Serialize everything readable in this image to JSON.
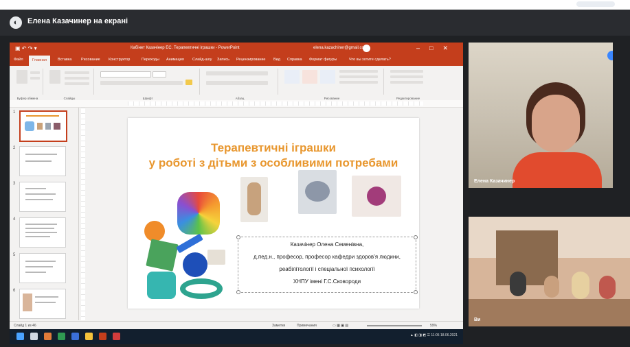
{
  "meet": {
    "presenter_banner": "Елена Казачинер на екрані",
    "presenter_tile_name": "Елена Казачинер",
    "group_tile_name": "Ви"
  },
  "ppt": {
    "window_title": "Кабінет Казачінер ЕС. Терапевтичні іграшки - PowerPoint",
    "account": "elena.kazachiner@gmail.com",
    "tabs": [
      "Файл",
      "Главная",
      "Вставка",
      "Рисование",
      "Конструктор",
      "Переходы",
      "Анимация",
      "Слайд-шоу",
      "Запись",
      "Рецензирование",
      "Вид",
      "Справка",
      "Формат фигуры",
      "Что вы хотите сделать?"
    ],
    "ribbon_groups": [
      "Буфер обмена",
      "Слайды",
      "Шрифт",
      "Абзац",
      "Рисование",
      "Редактирование"
    ],
    "slide_numbers": [
      "1",
      "2",
      "3",
      "4",
      "5",
      "6"
    ],
    "slide": {
      "title_line1": "Терапевтичні іграшки",
      "title_line2": "у роботі з дітьми з особливими потребами",
      "author_lines": [
        "Казачінер Олена Семенівна,",
        "д.пед.н., професор, професор кафедри здоров'я людини,",
        "реабілітології і спеціальної психології",
        "ХНПУ імені Г.С.Сковороди"
      ]
    },
    "status": {
      "left": "Слайд 1 из 46",
      "notes": "Заметки",
      "comments": "Примечания",
      "zoom": "59%"
    }
  },
  "taskbar": {
    "time": "11:05",
    "date": "18.06.2021"
  },
  "colors": {
    "ppt_accent": "#c43e1c",
    "title_orange": "#e8972f",
    "meet_bg": "#1f2124"
  }
}
